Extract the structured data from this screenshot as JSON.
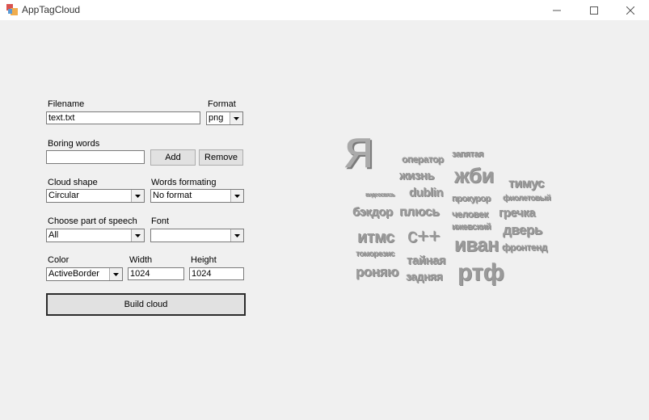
{
  "window": {
    "title": "AppTagCloud"
  },
  "form": {
    "filename": {
      "label": "Filename",
      "value": "text.txt"
    },
    "format": {
      "label": "Format",
      "value": "png"
    },
    "boring_words": {
      "label": "Boring words",
      "value": "",
      "add_label": "Add",
      "remove_label": "Remove"
    },
    "cloud_shape": {
      "label": "Cloud shape",
      "value": "Circular"
    },
    "words_formatting": {
      "label": "Words formating",
      "value": "No format"
    },
    "part_of_speech": {
      "label": "Choose part of speech",
      "value": "All"
    },
    "font": {
      "label": "Font",
      "value": ""
    },
    "color": {
      "label": "Color",
      "value": "ActiveBorder"
    },
    "width": {
      "label": "Width",
      "value": "1024"
    },
    "height": {
      "label": "Height",
      "value": "1024"
    },
    "build_label": "Build cloud"
  },
  "tag_cloud": {
    "words": [
      "я",
      "оператор",
      "запятая",
      "жизнь",
      "жби",
      "тимус",
      "видеосвязь",
      "dublin",
      "прокурор",
      "фиолетовый",
      "бэкдор",
      "плюсь",
      "человек",
      "гречка",
      "итмс",
      "с++",
      "ижевский",
      "дверь",
      "иван",
      "фронтенд",
      "томорезис",
      "тайная",
      "роняю",
      "задняя",
      "ртф"
    ],
    "color": "#9a9a9a"
  }
}
